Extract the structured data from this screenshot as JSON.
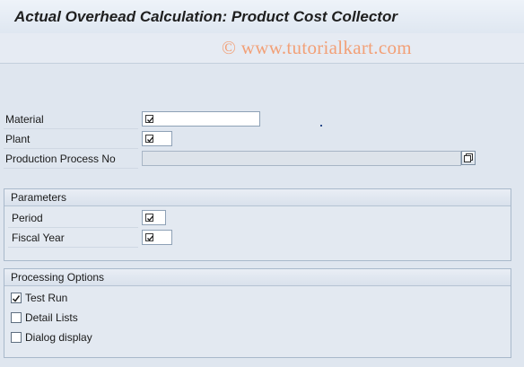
{
  "title": "Actual Overhead Calculation: Product Cost Collector",
  "watermark": "© www.tutorialkart.com",
  "selection": {
    "material_label": "Material",
    "plant_label": "Plant",
    "production_process_label": "Production Process No"
  },
  "parameters": {
    "title": "Parameters",
    "period_label": "Period",
    "fiscal_year_label": "Fiscal Year"
  },
  "processing_options": {
    "title": "Processing Options",
    "test_run": {
      "label": "Test Run",
      "checked": true
    },
    "detail_lists": {
      "label": "Detail Lists",
      "checked": false
    },
    "dialog_display": {
      "label": "Dialog display",
      "checked": false
    }
  },
  "icons": {
    "required": "required-field-checkmark-icon",
    "possible_entries": "possible-entries-icon"
  }
}
